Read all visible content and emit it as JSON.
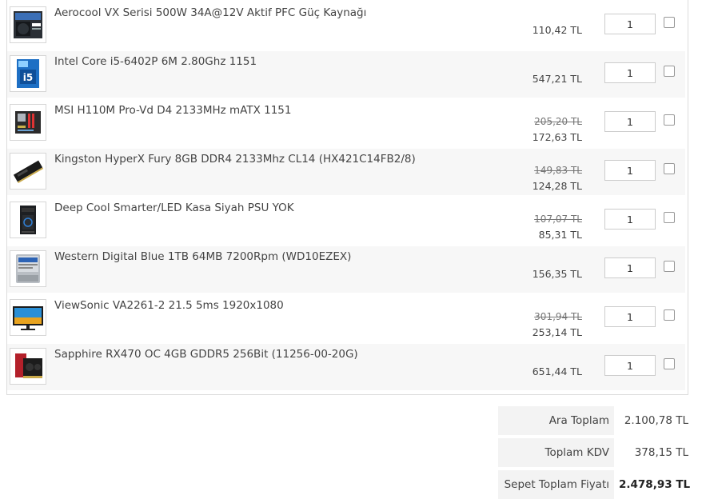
{
  "cart": {
    "items": [
      {
        "name": "Aerocool VX Serisi 500W 34A@12V Aktif PFC Güç Kaynağı",
        "old_price": "",
        "price": "110,42 TL",
        "qty": "1",
        "icon": "power-supply-icon"
      },
      {
        "name": "Intel Core i5-6402P 6M 2.80Ghz 1151",
        "old_price": "",
        "price": "547,21 TL",
        "qty": "1",
        "icon": "cpu-box-icon"
      },
      {
        "name": "MSI H110M Pro-Vd D4 2133MHz mATX 1151",
        "old_price": "205,20 TL",
        "price": "172,63 TL",
        "qty": "1",
        "icon": "motherboard-icon"
      },
      {
        "name": "Kingston HyperX Fury 8GB DDR4 2133Mhz CL14 (HX421C14FB2/8)",
        "old_price": "149,83 TL",
        "price": "124,28 TL",
        "qty": "1",
        "icon": "ram-icon"
      },
      {
        "name": "Deep Cool Smarter/LED Kasa Siyah PSU YOK",
        "old_price": "107,07 TL",
        "price": "85,31 TL",
        "qty": "1",
        "icon": "pc-case-icon"
      },
      {
        "name": "Western Digital Blue 1TB 64MB 7200Rpm (WD10EZEX)",
        "old_price": "",
        "price": "156,35 TL",
        "qty": "1",
        "icon": "hard-drive-icon"
      },
      {
        "name": "ViewSonic VA2261-2 21.5 5ms 1920x1080",
        "old_price": "301,94 TL",
        "price": "253,14 TL",
        "qty": "1",
        "icon": "monitor-icon"
      },
      {
        "name": "Sapphire RX470 OC 4GB GDDR5 256Bit (11256-00-20G)",
        "old_price": "",
        "price": "651,44 TL",
        "qty": "1",
        "icon": "graphics-card-icon"
      }
    ]
  },
  "totals": {
    "subtotal_label": "Ara Toplam",
    "subtotal_value": "2.100,78 TL",
    "vat_label": "Toplam KDV",
    "vat_value": "378,15 TL",
    "grand_label": "Sepet Toplam Fiyatı",
    "grand_value": "2.478,93 TL"
  }
}
